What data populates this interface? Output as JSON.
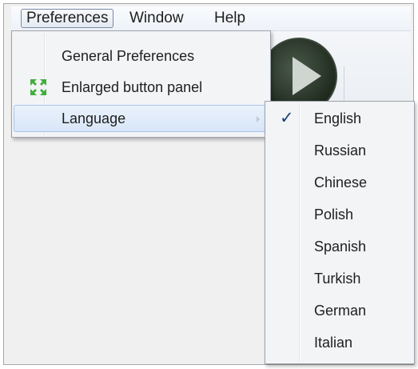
{
  "menubar": {
    "items": [
      {
        "label": "Preferences",
        "open": true
      },
      {
        "label": "Window"
      },
      {
        "label": "Help"
      }
    ]
  },
  "preferences_menu": {
    "items": [
      {
        "label": "General Preferences",
        "icon": null
      },
      {
        "label": "Enlarged button panel",
        "icon": "enlarge-arrows-icon"
      },
      {
        "label": "Language",
        "has_submenu": true,
        "highlighted": true
      }
    ]
  },
  "language_submenu": {
    "selected": "English",
    "check_glyph": "✓",
    "items": [
      "English",
      "Russian",
      "Chinese",
      "Polish",
      "Spanish",
      "Turkish",
      "German",
      "Italian"
    ]
  },
  "colors": {
    "highlight": "#d8e6f7",
    "check": "#1d3e7a",
    "icon_green": "#3fae3a"
  }
}
